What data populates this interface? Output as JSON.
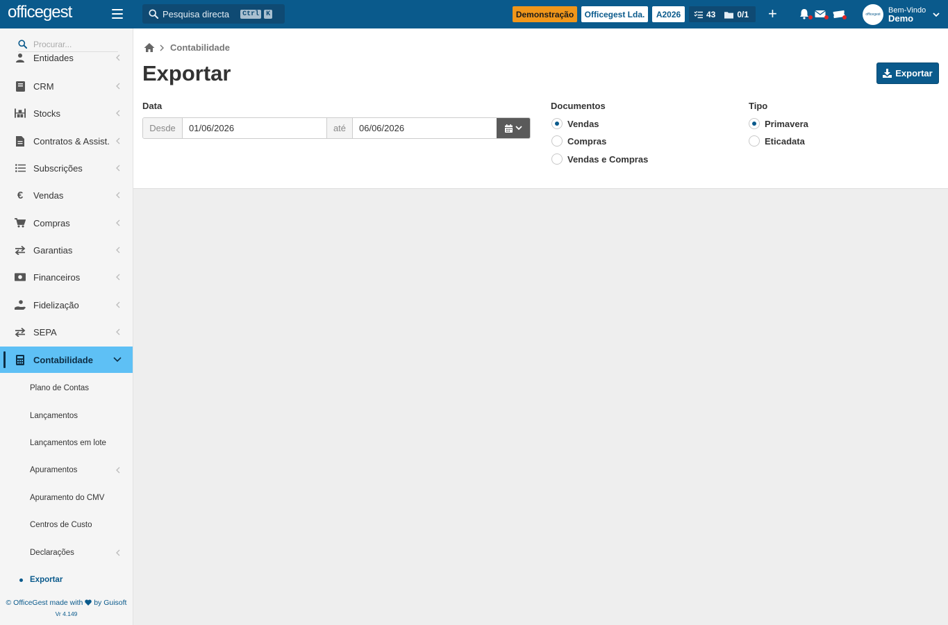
{
  "topbar": {
    "logo_text": "officegest",
    "search_placeholder": "Pesquisa directa",
    "shortcut_ctrl": "Ctrl",
    "shortcut_key": "K",
    "demo_badge": "Demonstração",
    "company_badge": "Officegest Lda.",
    "year_badge": "A2026",
    "tasks_count": "43",
    "folders_count": "0/1",
    "plus_label": "+",
    "avatar_text": "officegest",
    "welcome": "Bem-Vindo",
    "username": "Demo"
  },
  "sidebar": {
    "search_placeholder": "Procurar...",
    "items": [
      {
        "label": "Entidades",
        "icon": "user-icon"
      },
      {
        "label": "CRM",
        "icon": "book-icon"
      },
      {
        "label": "Stocks",
        "icon": "warehouse-icon"
      },
      {
        "label": "Contratos & Assist.",
        "icon": "contract-icon"
      },
      {
        "label": "Subscrições",
        "icon": "list-icon"
      },
      {
        "label": "Vendas",
        "icon": "euro-icon"
      },
      {
        "label": "Compras",
        "icon": "cart-icon"
      },
      {
        "label": "Garantias",
        "icon": "exchange-icon"
      },
      {
        "label": "Financeiros",
        "icon": "money-icon"
      },
      {
        "label": "Fidelização",
        "icon": "hand-coin-icon"
      },
      {
        "label": "SEPA",
        "icon": "exchange-icon"
      },
      {
        "label": "Contabilidade",
        "icon": "calculator-icon"
      }
    ],
    "sub_items": [
      {
        "label": "Plano de Contas"
      },
      {
        "label": "Lançamentos"
      },
      {
        "label": "Lançamentos em lote"
      },
      {
        "label": "Apuramentos"
      },
      {
        "label": "Apuramento do CMV"
      },
      {
        "label": "Centros de Custo"
      },
      {
        "label": "Declarações"
      },
      {
        "label": "Exportar"
      }
    ],
    "footer_prefix": "© OfficeGest made with",
    "footer_suffix": "by Guisoft",
    "version": "Vr 4.149"
  },
  "main": {
    "breadcrumb": "Contabilidade",
    "title": "Exportar",
    "export_button": "Exportar",
    "date": {
      "label": "Data",
      "from_label": "Desde",
      "from_value": "01/06/2026",
      "to_label": "até",
      "to_value": "06/06/2026"
    },
    "documents": {
      "label": "Documentos",
      "options": [
        "Vendas",
        "Compras",
        "Vendas e Compras"
      ],
      "selected": "Vendas"
    },
    "type": {
      "label": "Tipo",
      "options": [
        "Primavera",
        "Eticadata"
      ],
      "selected": "Primavera"
    }
  },
  "colors": {
    "brand": "#0a5a8c",
    "active_menu": "#5ec0f5",
    "demo_badge": "#f0961a",
    "notification_dot": "#e02424"
  }
}
